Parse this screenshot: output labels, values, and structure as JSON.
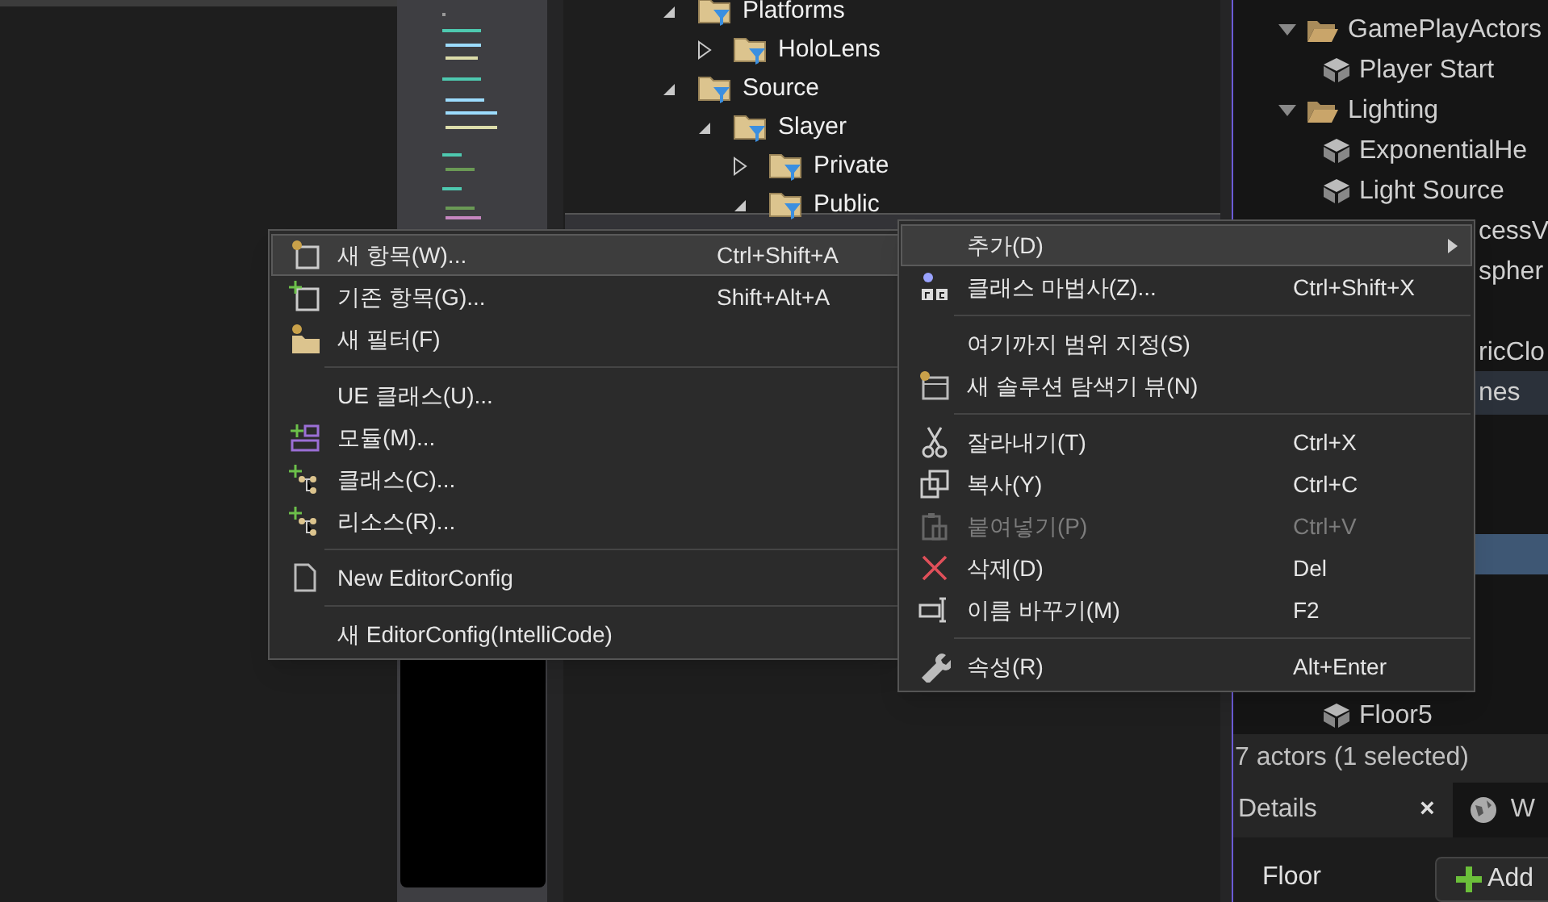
{
  "solution_tree": [
    {
      "label": "Platforms",
      "expanded": true,
      "children": [
        {
          "label": "HoloLens",
          "expanded": false
        }
      ]
    },
    {
      "label": "Source",
      "expanded": true,
      "children": [
        {
          "label": "Slayer",
          "expanded": true,
          "children": [
            {
              "label": "Private",
              "expanded": false
            },
            {
              "label": "Public",
              "expanded": true
            }
          ]
        }
      ]
    }
  ],
  "outliner": {
    "rows": [
      {
        "kind": "folder",
        "label": "GamePlayActors",
        "expanded": true,
        "selected": false,
        "highlighted": false
      },
      {
        "kind": "actor",
        "label": "Player Start",
        "selected": false,
        "highlighted": false
      },
      {
        "kind": "folder",
        "label": "Lighting",
        "expanded": true,
        "selected": false,
        "highlighted": false
      },
      {
        "kind": "actor",
        "label": "ExponentialHe",
        "selected": false,
        "highlighted": false
      },
      {
        "kind": "actor",
        "label": "Light Source",
        "selected": false,
        "highlighted": false
      },
      {
        "kind": "partial",
        "label": "cessV",
        "selected": false,
        "highlighted": false
      },
      {
        "kind": "partial",
        "label": "spher",
        "selected": false,
        "highlighted": false
      },
      {
        "kind": "blank",
        "selected": false,
        "highlighted": false
      },
      {
        "kind": "partial",
        "label": "ricClo",
        "selected": false,
        "highlighted": false
      },
      {
        "kind": "partial",
        "label": "nes",
        "selected": false,
        "highlighted": true
      },
      {
        "kind": "blank",
        "selected": false,
        "highlighted": false
      },
      {
        "kind": "blank",
        "selected": false,
        "highlighted": false
      },
      {
        "kind": "blank",
        "selected": false,
        "highlighted": false
      },
      {
        "kind": "blank",
        "selected": true,
        "highlighted": false
      },
      {
        "kind": "blank",
        "selected": false,
        "highlighted": false
      },
      {
        "kind": "blank",
        "selected": false,
        "highlighted": false
      },
      {
        "kind": "blank",
        "selected": false,
        "highlighted": false
      },
      {
        "kind": "actor",
        "label": "Floor5",
        "selected": false,
        "highlighted": false
      }
    ],
    "status": "7 actors (1 selected)"
  },
  "details_tabs": [
    {
      "label": "Details",
      "selected": true,
      "close": "×"
    },
    {
      "label": "W",
      "selected": false
    }
  ],
  "details": {
    "title": "Floor",
    "add_button": "Add"
  },
  "menus": [
    {
      "items": [
        {
          "kind": "item",
          "label": "새 항목(W)...",
          "shortcut": "Ctrl+Shift+A",
          "selected": true,
          "disabled": false,
          "submenu": false
        },
        {
          "kind": "item",
          "label": "기존 항목(G)...",
          "shortcut": "Shift+Alt+A",
          "selected": false,
          "disabled": false,
          "submenu": false
        },
        {
          "kind": "item",
          "label": "새 필터(F)",
          "selected": false,
          "disabled": false,
          "submenu": false
        },
        {
          "kind": "separator"
        },
        {
          "kind": "item",
          "label": "UE 클래스(U)...",
          "selected": false,
          "disabled": false,
          "submenu": false
        },
        {
          "kind": "item",
          "label": "모듈(M)...",
          "selected": false,
          "disabled": false,
          "submenu": false
        },
        {
          "kind": "item",
          "label": "클래스(C)...",
          "selected": false,
          "disabled": false,
          "submenu": false
        },
        {
          "kind": "item",
          "label": "리소스(R)...",
          "selected": false,
          "disabled": false,
          "submenu": false
        },
        {
          "kind": "separator"
        },
        {
          "kind": "item",
          "label": "New EditorConfig",
          "selected": false,
          "disabled": false,
          "submenu": false
        },
        {
          "kind": "separator"
        },
        {
          "kind": "item",
          "label": "새 EditorConfig(IntelliCode)",
          "selected": false,
          "disabled": false,
          "submenu": false
        }
      ]
    },
    {
      "items": [
        {
          "kind": "item",
          "label": "추가(D)",
          "selected": true,
          "disabled": false,
          "submenu": true
        },
        {
          "kind": "item",
          "label": "클래스 마법사(Z)...",
          "shortcut": "Ctrl+Shift+X",
          "selected": false,
          "disabled": false,
          "submenu": false
        },
        {
          "kind": "separator"
        },
        {
          "kind": "item",
          "label": "여기까지 범위 지정(S)",
          "selected": false,
          "disabled": false,
          "submenu": false
        },
        {
          "kind": "item",
          "label": "새 솔루션 탐색기 뷰(N)",
          "selected": false,
          "disabled": false,
          "submenu": false
        },
        {
          "kind": "separator"
        },
        {
          "kind": "item",
          "label": "잘라내기(T)",
          "shortcut": "Ctrl+X",
          "selected": false,
          "disabled": false,
          "submenu": false
        },
        {
          "kind": "item",
          "label": "복사(Y)",
          "shortcut": "Ctrl+C",
          "selected": false,
          "disabled": false,
          "submenu": false
        },
        {
          "kind": "item",
          "label": "붙여넣기(P)",
          "shortcut": "Ctrl+V",
          "selected": false,
          "disabled": true,
          "submenu": false
        },
        {
          "kind": "item",
          "label": "삭제(D)",
          "shortcut": "Del",
          "selected": false,
          "disabled": false,
          "submenu": false
        },
        {
          "kind": "item",
          "label": "이름 바꾸기(M)",
          "shortcut": "F2",
          "selected": false,
          "disabled": false,
          "submenu": false
        },
        {
          "kind": "separator"
        },
        {
          "kind": "item",
          "label": "속성(R)",
          "shortcut": "Alt+Enter",
          "selected": false,
          "disabled": false,
          "submenu": false
        }
      ]
    }
  ]
}
